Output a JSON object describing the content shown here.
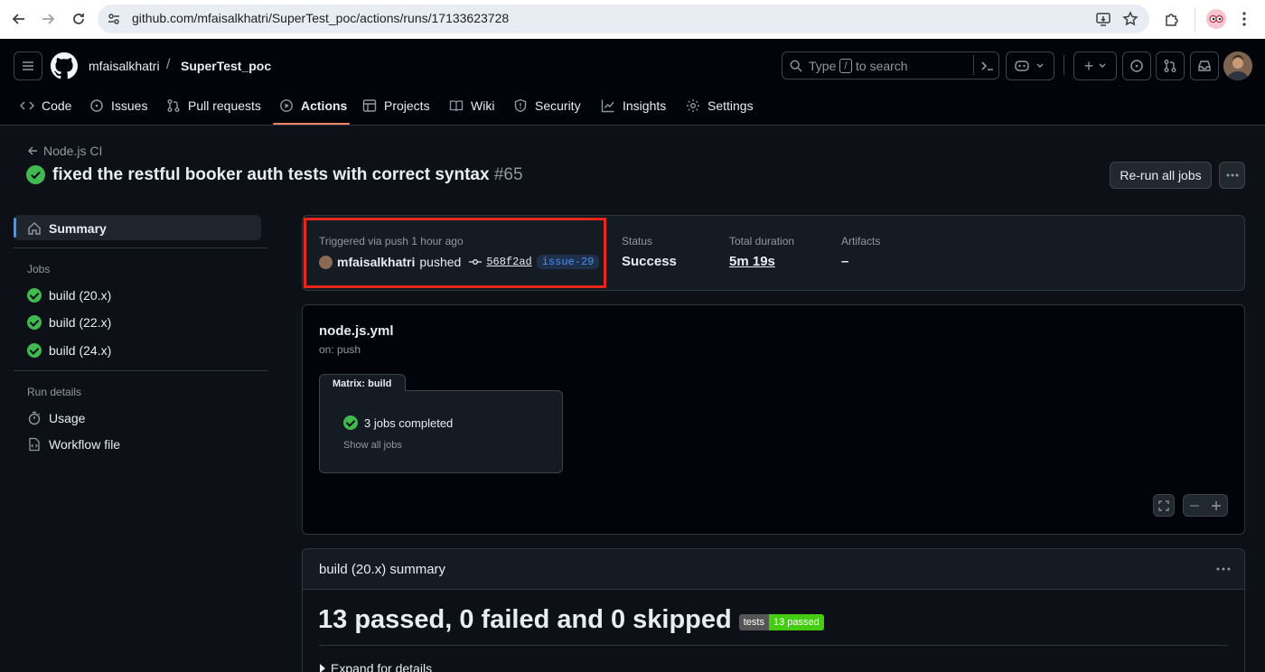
{
  "browser": {
    "url": "github.com/mfaisalkhatri/SuperTest_poc/actions/runs/17133623728"
  },
  "header": {
    "owner": "mfaisalkhatri",
    "separator": "/",
    "repo": "SuperTest_poc",
    "search_prefix": "Type",
    "search_key": "/",
    "search_suffix": "to search",
    "plus": "+"
  },
  "nav": {
    "items": [
      {
        "label": "Code"
      },
      {
        "label": "Issues"
      },
      {
        "label": "Pull requests"
      },
      {
        "label": "Actions"
      },
      {
        "label": "Projects"
      },
      {
        "label": "Wiki"
      },
      {
        "label": "Security"
      },
      {
        "label": "Insights"
      },
      {
        "label": "Settings"
      }
    ],
    "active": "Actions"
  },
  "run": {
    "back_link": "Node.js CI",
    "title": "fixed the restful booker auth tests with correct syntax",
    "number": "#65",
    "rerun_label": "Re-run all jobs"
  },
  "sidebar": {
    "summary_label": "Summary",
    "jobs_heading": "Jobs",
    "jobs": [
      {
        "label": "build (20.x)"
      },
      {
        "label": "build (22.x)"
      },
      {
        "label": "build (24.x)"
      }
    ],
    "run_details_heading": "Run details",
    "details": [
      {
        "label": "Usage"
      },
      {
        "label": "Workflow file"
      }
    ]
  },
  "summary_card": {
    "trigger_text": "Triggered via push 1 hour ago",
    "actor": "mfaisalkhatri",
    "action": "pushed",
    "commit": "568f2ad",
    "branch": "issue-29",
    "status_label": "Status",
    "status_value": "Success",
    "duration_label": "Total duration",
    "duration_value": "5m 19s",
    "artifacts_label": "Artifacts",
    "artifacts_value": "–",
    "highlight_color": "#e5271b"
  },
  "workflow_card": {
    "file": "node.js.yml",
    "trigger": "on: push",
    "matrix_tab": "Matrix: build",
    "jobs_completed": "3 jobs completed",
    "show_all": "Show all jobs"
  },
  "job_summary": {
    "title": "build (20.x) summary",
    "result_text": "13 passed, 0 failed and 0 skipped",
    "badge_left": "tests",
    "badge_right": "13 passed",
    "expand_text": "Expand for details"
  },
  "colors": {
    "success": "#3fb950",
    "active_underline": "#f78166",
    "badge_green": "#4c1"
  }
}
